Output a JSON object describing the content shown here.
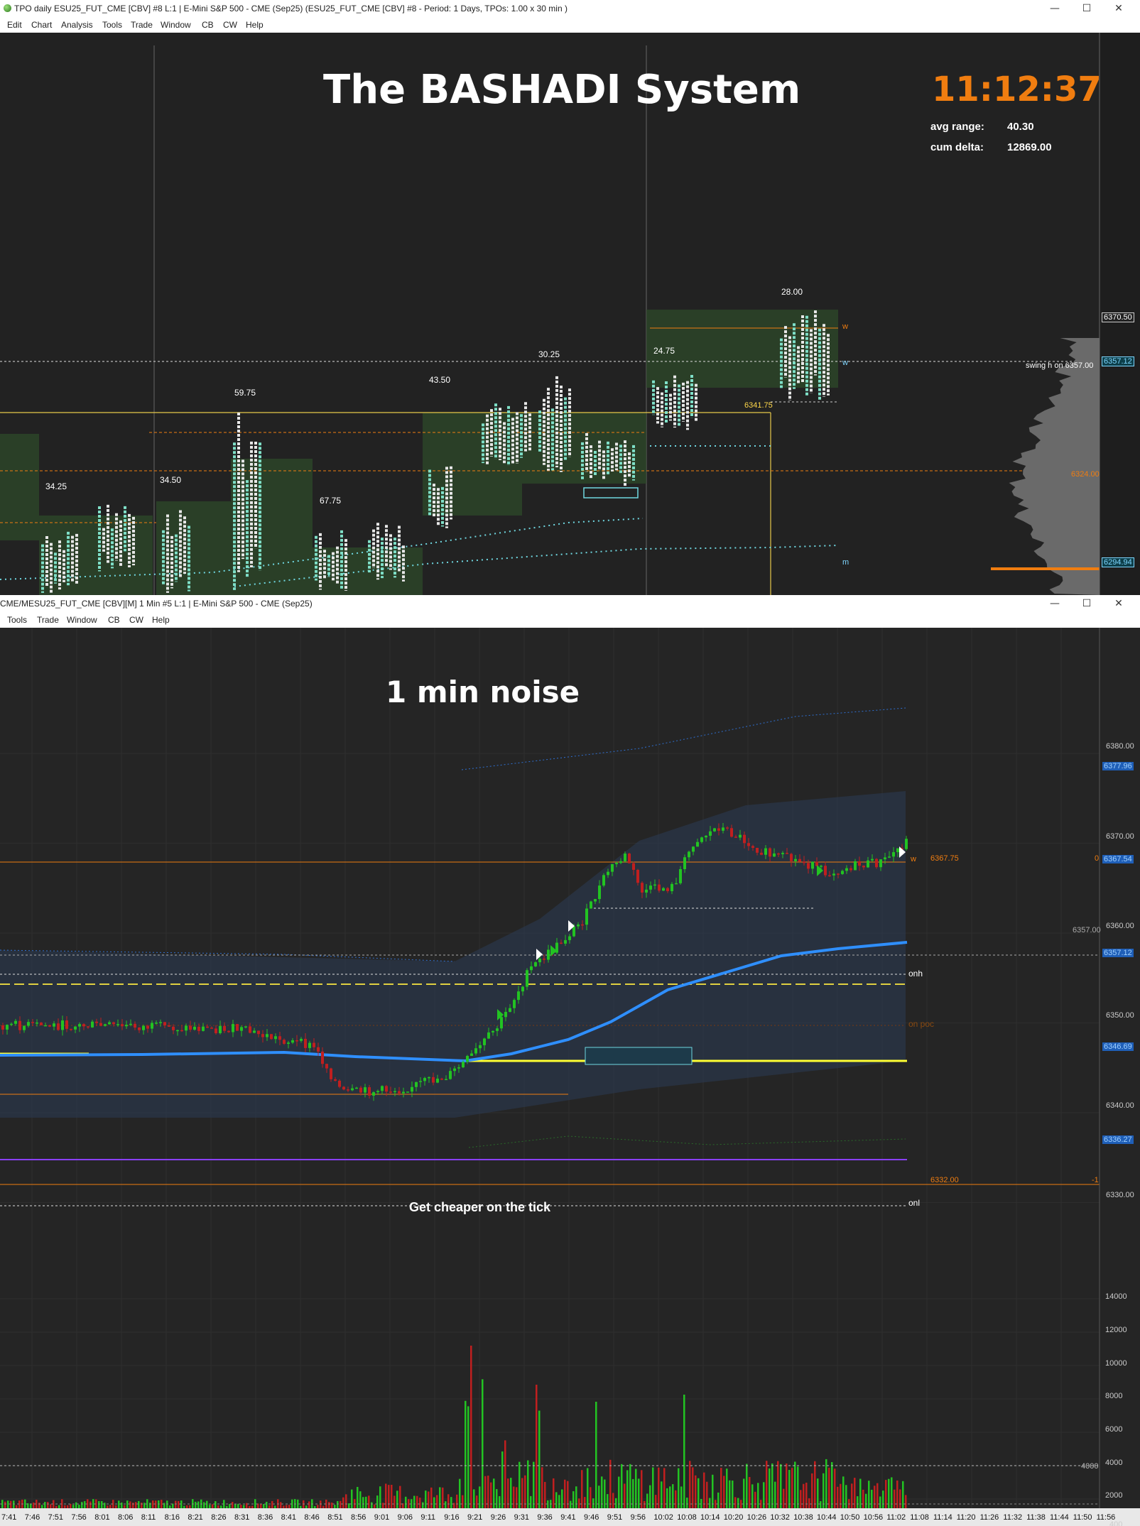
{
  "window1": {
    "title": "TPO daily ESU25_FUT_CME [CBV] #8 L:1 | E-Mini S&P 500 - CME (Sep25) (ESU25_FUT_CME [CBV] #8 - Period: 1 Days, TPOs: 1.00 x 30 min )",
    "menu": [
      "Edit",
      "Chart",
      "Analysis",
      "Tools",
      "Trade",
      "Window",
      "CB",
      "CW",
      "Help"
    ],
    "heading": "The BASHADI System",
    "clock": "11:12:37",
    "stats": [
      {
        "label": "avg range:",
        "value": "40.30"
      },
      {
        "label": "cum delta:",
        "value": "12869.00"
      }
    ],
    "range_labels": [
      "34.25",
      "34.50",
      "59.75",
      "67.75",
      "43.50",
      "30.25",
      "24.75",
      "28.00"
    ],
    "level_labels": {
      "swing": "swing h on  6357.00",
      "open_level": "6341.75",
      "w_mark": "w",
      "m_mark": "m"
    },
    "price_tags": [
      {
        "text": "6370.50",
        "color": "#ffffff"
      },
      {
        "text": "6357.12",
        "color": "#7fd6ff"
      },
      {
        "text": "6324.00",
        "color": "#f07d10"
      },
      {
        "text": "6294.94",
        "color": "#7fd6ff"
      }
    ]
  },
  "window2": {
    "title": "CME/MESU25_FUT_CME [CBV][M]  1 Min  #5 L:1 | E-Mini S&P 500 - CME (Sep25)",
    "menu": [
      "Tools",
      "Trade",
      "Window",
      "CB",
      "CW",
      "Help"
    ],
    "heading": "1 min noise",
    "note": "Get cheaper on the tick",
    "labels": {
      "onh": "onh",
      "onl": "onl",
      "on_poc": "on poc",
      "w": "w",
      "level_6367": "6367.75",
      "level_6332": "6332.00",
      "level_6357": "6357.00",
      "zero": "0",
      "minus_one": "-1"
    },
    "price_axis": [
      "6380.00",
      "6370.00",
      "6360.00",
      "6350.00",
      "6340.00",
      "6330.00"
    ],
    "price_tags": [
      {
        "text": "6377.96",
        "color": "#2f8fff"
      },
      {
        "text": "6367.54",
        "color": "#2f8fff"
      },
      {
        "text": "6357.12",
        "color": "#2f8fff"
      },
      {
        "text": "6346.69",
        "color": "#2f8fff"
      },
      {
        "text": "6336.27",
        "color": "#2f8fff"
      }
    ],
    "volume_axis": [
      "14000",
      "12000",
      "10000",
      "8000",
      "6000",
      "4000",
      "2000",
      "400"
    ],
    "volume_level": "4000",
    "time_axis": [
      "7:41",
      "7:46",
      "7:51",
      "7:56",
      "8:01",
      "8:06",
      "8:11",
      "8:16",
      "8:21",
      "8:26",
      "8:31",
      "8:36",
      "8:41",
      "8:46",
      "8:51",
      "8:56",
      "9:01",
      "9:06",
      "9:11",
      "9:16",
      "9:21",
      "9:26",
      "9:31",
      "9:36",
      "9:41",
      "9:46",
      "9:51",
      "9:56",
      "10:02",
      "10:08",
      "10:14",
      "10:20",
      "10:26",
      "10:32",
      "10:38",
      "10:44",
      "10:50",
      "10:56",
      "11:02",
      "11:08",
      "11:14",
      "11:20",
      "11:26",
      "11:32",
      "11:38",
      "11:44",
      "11:50",
      "11:56"
    ],
    "last_tag": "5"
  },
  "window_controls": {
    "minimize": "—",
    "maximize": "☐",
    "close": "✕"
  },
  "colors": {
    "bg": "#222222",
    "tpo_box": "#2d4a2a",
    "orange": "#f07d10",
    "yellow": "#ffff33",
    "blue": "#2f8fff",
    "up": "#22c322",
    "down": "#c11f1f",
    "cyan": "#6fd7e0",
    "purple": "#8a3fff"
  }
}
